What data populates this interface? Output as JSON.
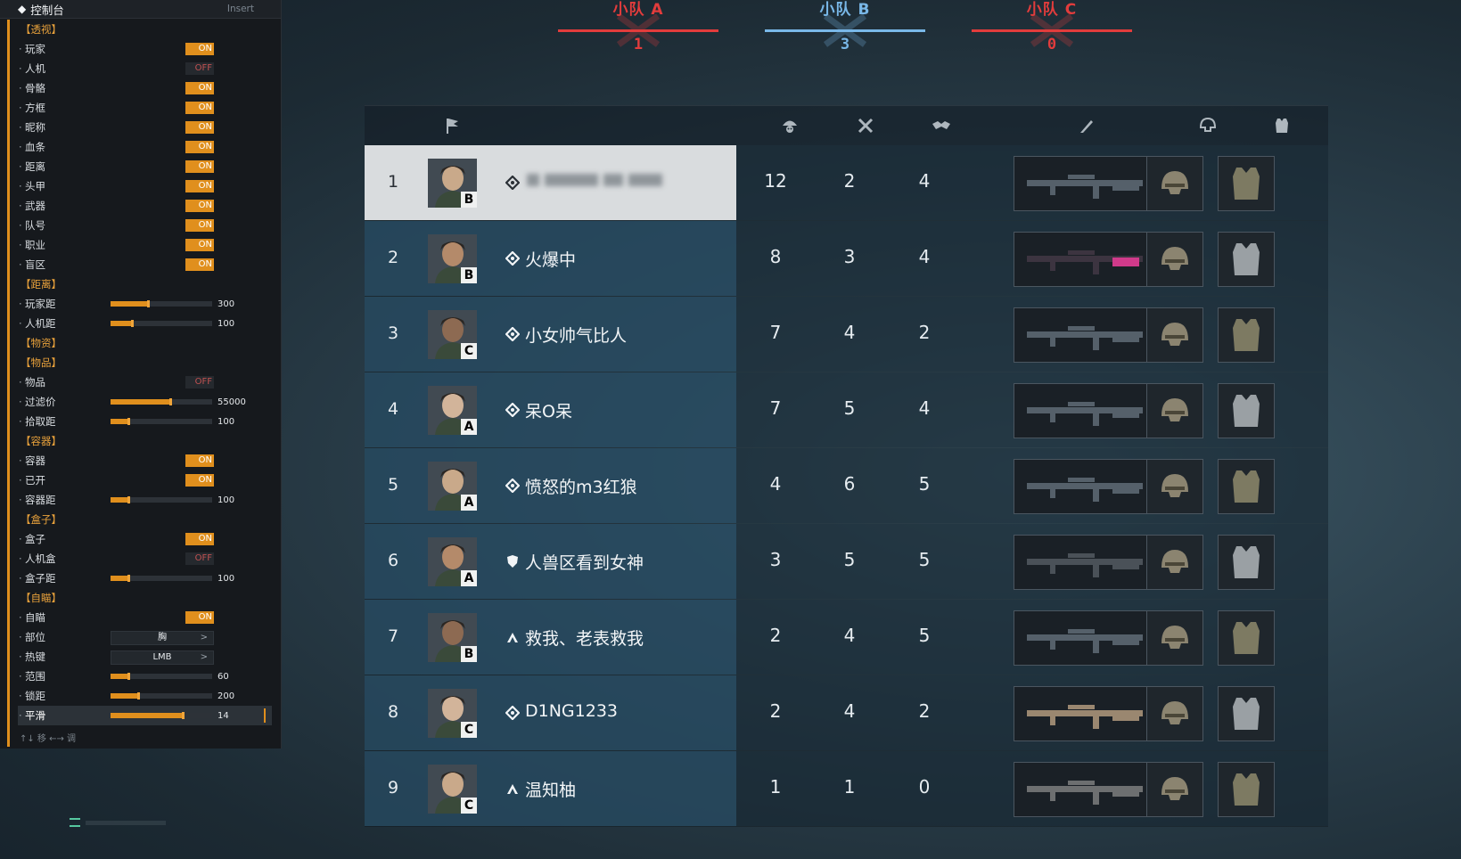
{
  "panel": {
    "title": "控制台",
    "hotkey": "Insert",
    "hint": "↑↓ 移 ←→ 调",
    "rows": [
      {
        "kind": "section",
        "label": "【透视】"
      },
      {
        "kind": "toggle",
        "label": "玩家",
        "value": "ON"
      },
      {
        "kind": "toggle",
        "label": "人机",
        "value": "OFF"
      },
      {
        "kind": "toggle",
        "label": "骨骼",
        "value": "ON"
      },
      {
        "kind": "toggle",
        "label": "方框",
        "value": "ON"
      },
      {
        "kind": "toggle",
        "label": "昵称",
        "value": "ON"
      },
      {
        "kind": "toggle",
        "label": "血条",
        "value": "ON"
      },
      {
        "kind": "toggle",
        "label": "距离",
        "value": "ON"
      },
      {
        "kind": "toggle",
        "label": "头甲",
        "value": "ON"
      },
      {
        "kind": "toggle",
        "label": "武器",
        "value": "ON"
      },
      {
        "kind": "toggle",
        "label": "队号",
        "value": "ON"
      },
      {
        "kind": "toggle",
        "label": "职业",
        "value": "ON"
      },
      {
        "kind": "toggle",
        "label": "盲区",
        "value": "ON"
      },
      {
        "kind": "section",
        "label": "【距离】"
      },
      {
        "kind": "slider",
        "label": "玩家距",
        "value": "300",
        "fraction": 0.38
      },
      {
        "kind": "slider",
        "label": "人机距",
        "value": "100",
        "fraction": 0.22
      },
      {
        "kind": "section",
        "label": "【物资】"
      },
      {
        "kind": "section",
        "label": "【物品】"
      },
      {
        "kind": "toggle",
        "label": "物品",
        "value": "OFF"
      },
      {
        "kind": "slider",
        "label": "过滤价",
        "value": "55000",
        "fraction": 0.6
      },
      {
        "kind": "slider",
        "label": "拾取距",
        "value": "100",
        "fraction": 0.18
      },
      {
        "kind": "section",
        "label": "【容器】"
      },
      {
        "kind": "toggle",
        "label": "容器",
        "value": "ON"
      },
      {
        "kind": "toggle",
        "label": "已开",
        "value": "ON"
      },
      {
        "kind": "slider",
        "label": "容器距",
        "value": "100",
        "fraction": 0.18
      },
      {
        "kind": "section",
        "label": "【盒子】"
      },
      {
        "kind": "toggle",
        "label": "盒子",
        "value": "ON"
      },
      {
        "kind": "toggle",
        "label": "人机盒",
        "value": "OFF"
      },
      {
        "kind": "slider",
        "label": "盒子距",
        "value": "100",
        "fraction": 0.18
      },
      {
        "kind": "section",
        "label": "【自瞄】"
      },
      {
        "kind": "toggle",
        "label": "自瞄",
        "value": "ON"
      },
      {
        "kind": "select",
        "label": "部位",
        "value": "胸"
      },
      {
        "kind": "select",
        "label": "热键",
        "value": "LMB"
      },
      {
        "kind": "slider",
        "label": "范围",
        "value": "60",
        "fraction": 0.18
      },
      {
        "kind": "slider",
        "label": "锁距",
        "value": "200",
        "fraction": 0.28
      },
      {
        "kind": "slider",
        "label": "平滑",
        "value": "14",
        "fraction": 0.72,
        "active": true
      }
    ]
  },
  "teams": [
    {
      "name": "小队 A",
      "score": "1",
      "color": "#e23c3c"
    },
    {
      "name": "小队 B",
      "score": "3",
      "color": "#79b8e8"
    },
    {
      "name": "小队 C",
      "score": "0",
      "color": "#e23c3c"
    }
  ],
  "scoreboard": {
    "header_icons": [
      "flag-icon",
      "helmet-skull-icon",
      "crossed-swords-icon",
      "handshake-icon",
      "knife-icon",
      "helmet-icon",
      "armor-vest-icon"
    ],
    "players": [
      {
        "rank": "1",
        "squad": "B",
        "role": "assault",
        "name": "",
        "kills": "12",
        "deaths": "2",
        "assists": "4",
        "highlight": true
      },
      {
        "rank": "2",
        "squad": "B",
        "role": "assault",
        "name": "火爆中",
        "kills": "8",
        "deaths": "3",
        "assists": "4"
      },
      {
        "rank": "3",
        "squad": "C",
        "role": "assault",
        "name": "小女帅气比人",
        "kills": "7",
        "deaths": "4",
        "assists": "2"
      },
      {
        "rank": "4",
        "squad": "A",
        "role": "assault",
        "name": "呆O呆",
        "kills": "7",
        "deaths": "5",
        "assists": "4"
      },
      {
        "rank": "5",
        "squad": "A",
        "role": "assault",
        "name": "愤怒的m3红狼",
        "kills": "4",
        "deaths": "6",
        "assists": "5"
      },
      {
        "rank": "6",
        "squad": "A",
        "role": "engineer",
        "name": "人兽区看到女神",
        "kills": "3",
        "deaths": "5",
        "assists": "5"
      },
      {
        "rank": "7",
        "squad": "B",
        "role": "recon",
        "name": "救我、老表救我",
        "kills": "2",
        "deaths": "4",
        "assists": "5"
      },
      {
        "rank": "8",
        "squad": "C",
        "role": "assault",
        "name": "D1NG1233",
        "kills": "2",
        "deaths": "4",
        "assists": "2"
      },
      {
        "rank": "9",
        "squad": "C",
        "role": "recon",
        "name": "温知柚",
        "kills": "1",
        "deaths": "1",
        "assists": "0"
      }
    ]
  }
}
